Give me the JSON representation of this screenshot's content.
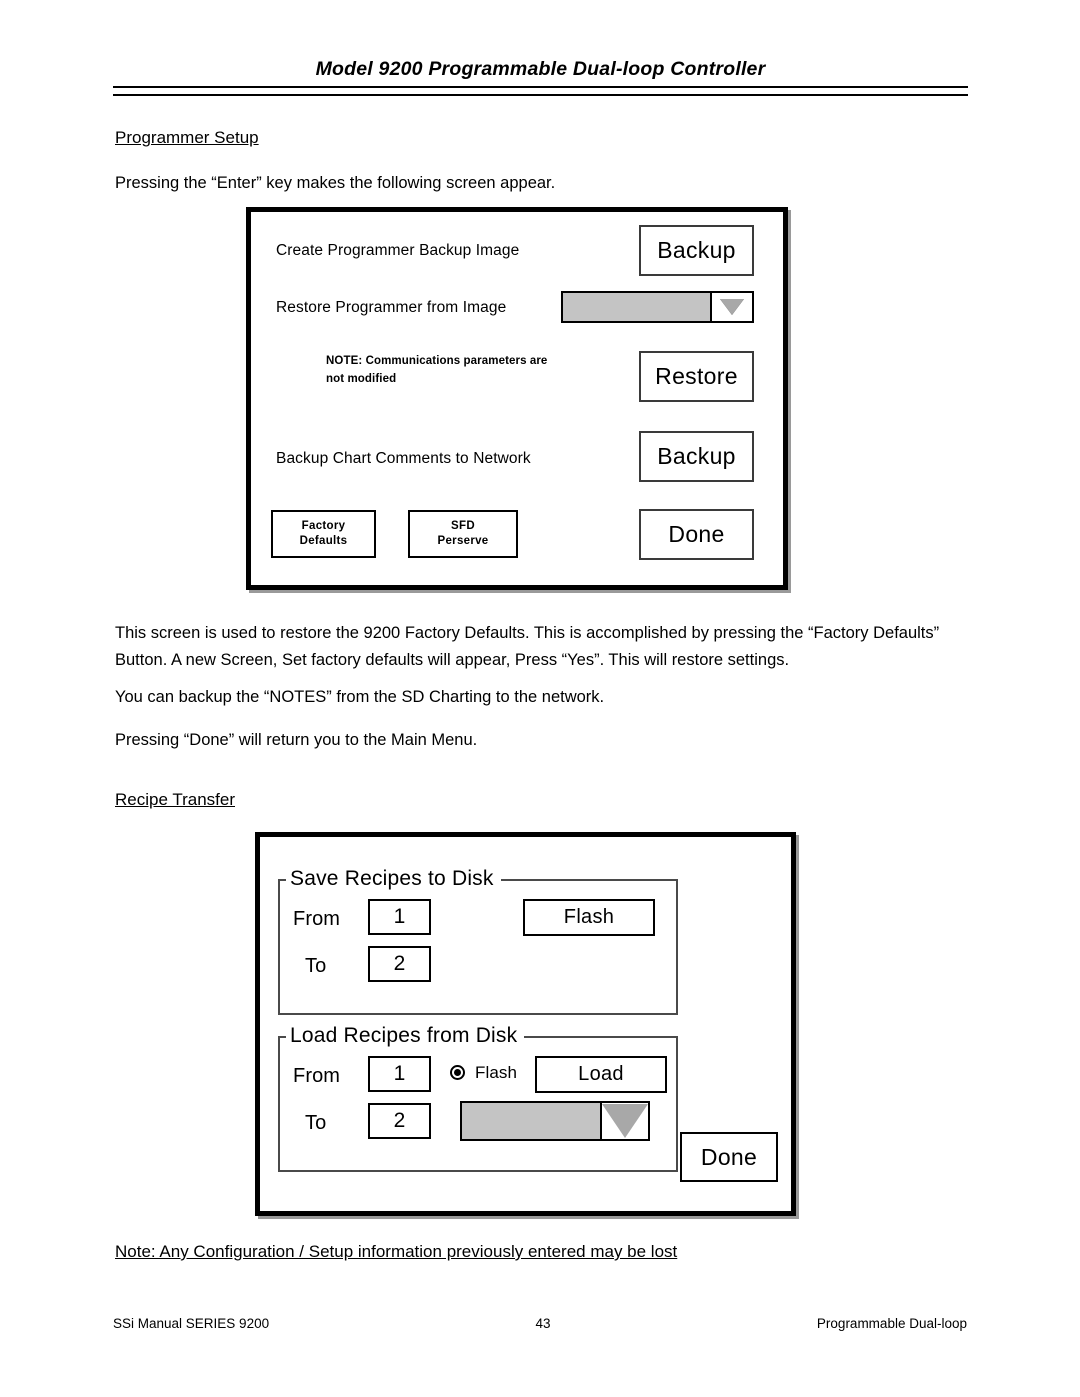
{
  "header": {
    "title": "Model 9200 Programmable Dual-loop Controller"
  },
  "sections": {
    "programmer_setup_heading": "Programmer Setup",
    "programmer_setup_intro": "Pressing the “Enter” key makes the following screen appear.",
    "recipe_transfer_heading": "Recipe Transfer"
  },
  "paragraphs": {
    "p1": "This screen is used to restore the 9200 Factory Defaults. This is accomplished by pressing the “Factory Defaults” Button. A new Screen, Set factory defaults will appear, Press “Yes”. This will restore settings.",
    "p2": "You can backup the “NOTES” from the SD Charting to the network.",
    "p3": "Pressing “Done” will return you to the Main Menu.",
    "note": "Note: Any Configuration / Setup information previously entered may be lost"
  },
  "programmer_setup_dialog": {
    "create_backup_label": "Create Programmer Backup Image",
    "create_backup_button": "Backup",
    "restore_from_image_label": "Restore Programmer from Image",
    "restore_image_combo_value": "",
    "note_line1": "NOTE: Communications parameters are",
    "note_line2": "not modified",
    "restore_button": "Restore",
    "backup_comments_label": "Backup Chart Comments to Network",
    "backup_comments_button": "Backup",
    "factory_defaults_line1": "Factory",
    "factory_defaults_line2": "Defaults",
    "sfd_preserve_line1": "SFD",
    "sfd_preserve_line2": "Perserve",
    "done_button": "Done"
  },
  "recipe_transfer_dialog": {
    "save_group_legend": "Save Recipes to Disk",
    "save_from_label": "From",
    "save_from_value": "1",
    "save_to_label": "To",
    "save_to_value": "2",
    "flash_button": "Flash",
    "load_group_legend": "Load Recipes from Disk",
    "load_from_label": "From",
    "load_from_value": "1",
    "load_to_label": "To",
    "load_to_value": "2",
    "flash_radio_label": "Flash",
    "load_button": "Load",
    "load_combo_value": "",
    "done_button": "Done"
  },
  "footer": {
    "left": "SSi Manual SERIES 9200",
    "page_number": "43",
    "right": "Programmable Dual-loop"
  },
  "colors": {
    "ink": "#000000",
    "combo_field": "#c4c4c4",
    "combo_arrow_fill": "#a8a8a8",
    "page_background": "#ffffff"
  }
}
